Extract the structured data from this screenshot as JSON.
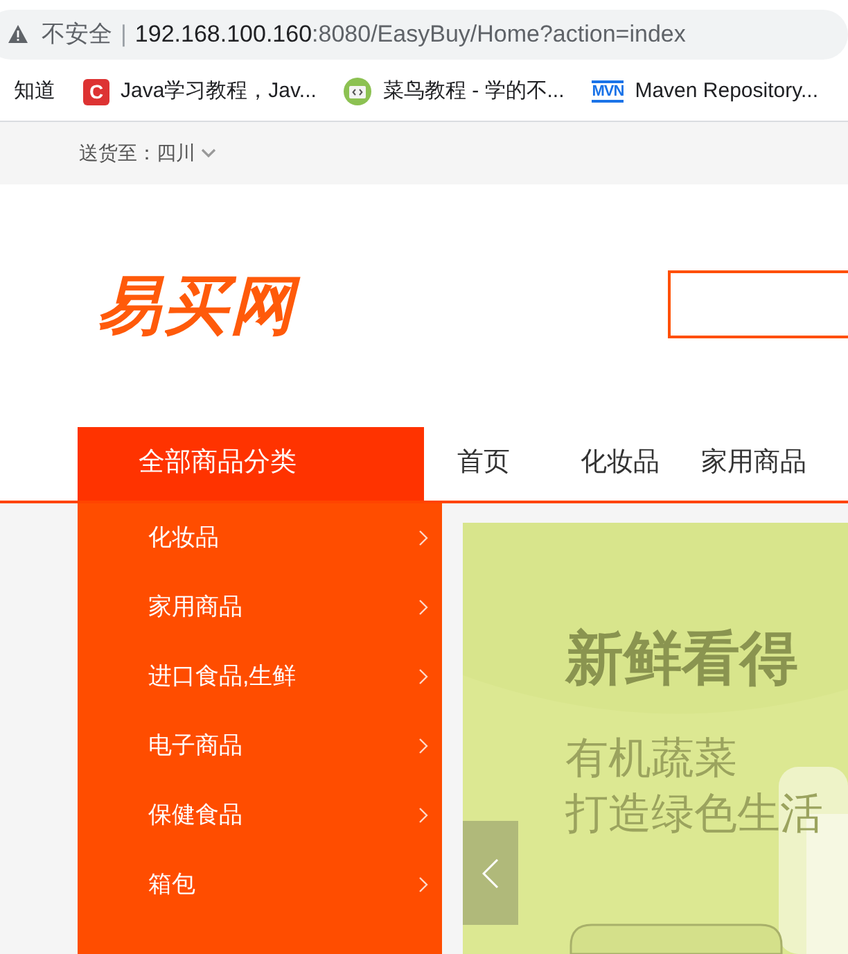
{
  "address_bar": {
    "security": "不安全",
    "separator": "|",
    "host": "192.168.100.160",
    "path": ":8080/EasyBuy/Home?action=index"
  },
  "bookmarks": [
    {
      "kind": "plain",
      "label": "知道"
    },
    {
      "kind": "letter",
      "icon_text": "C",
      "label": "Java学习教程，Jav..."
    },
    {
      "kind": "code",
      "label": "菜鸟教程 - 学的不..."
    },
    {
      "kind": "mvn",
      "icon_text": "MVN",
      "label": "Maven Repository..."
    }
  ],
  "top_bar": {
    "deliver_label": "送货至：",
    "region": "四川"
  },
  "logo": "易买网",
  "nav": {
    "category_header": "全部商品分类",
    "links": [
      "首页",
      "化妆品",
      "家用商品"
    ]
  },
  "categories": [
    "化妆品",
    "家用商品",
    "进口食品,生鲜",
    "电子商品",
    "保健食品",
    "箱包"
  ],
  "banner": {
    "kind": "picture",
    "headline": "新鲜看得",
    "line_1": "有机蔬菜",
    "line_2": "打造绿色生活"
  }
}
